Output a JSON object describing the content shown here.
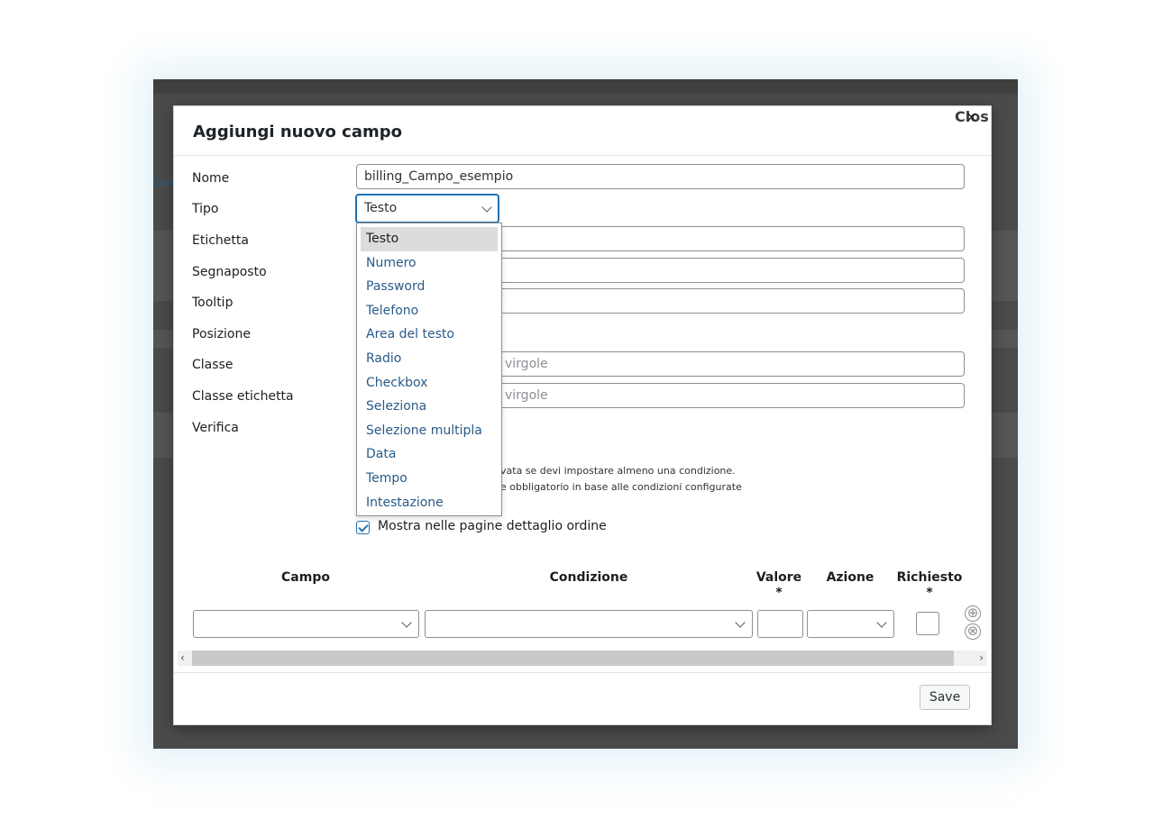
{
  "modal": {
    "title": "Aggiungi nuovo campo",
    "close_label": "Close",
    "close_icon": "×"
  },
  "form": {
    "nome_label": "Nome",
    "nome_value": "billing_Campo_esempio",
    "tipo_label": "Tipo",
    "tipo_value": "Testo",
    "etichetta_label": "Etichetta",
    "segnaposto_label": "Segnaposto",
    "tooltip_label": "Tooltip",
    "posizione_label": "Posizione",
    "classe_label": "Classe",
    "classe_placeholder_visible": "virgole",
    "classe_etichetta_label": "Classe etichetta",
    "classe_etichetta_placeholder_visible": "virgole",
    "verifica_label": "Verifica",
    "note_1_visible": "vata se devi impostare almeno una condizione.",
    "note_2_visible": "e obbligatorio in base alle condizioni configurate",
    "show_order_label": "Mostra nelle pagine dettaglio ordine",
    "show_order_checked": true
  },
  "type_options": [
    "Testo",
    "Numero",
    "Password",
    "Telefono",
    "Area del testo",
    "Radio",
    "Checkbox",
    "Seleziona",
    "Selezione multipla",
    "Data",
    "Tempo",
    "Intestazione"
  ],
  "conditions_table": {
    "headers": {
      "campo": "Campo",
      "condizione": "Condizione",
      "valore": "Valore",
      "valore_req": "*",
      "azione": "Azione",
      "richiesto": "Richiesto",
      "richiesto_req": "*"
    },
    "add_icon": "⊕",
    "remove_icon": "⊗"
  },
  "footer": {
    "save_label": "Save"
  },
  "background": {
    "link_fragment": "Cam"
  },
  "colors": {
    "accent": "#2271b1",
    "option_text": "#2a5a87",
    "overlay": "#4a4a4a"
  }
}
